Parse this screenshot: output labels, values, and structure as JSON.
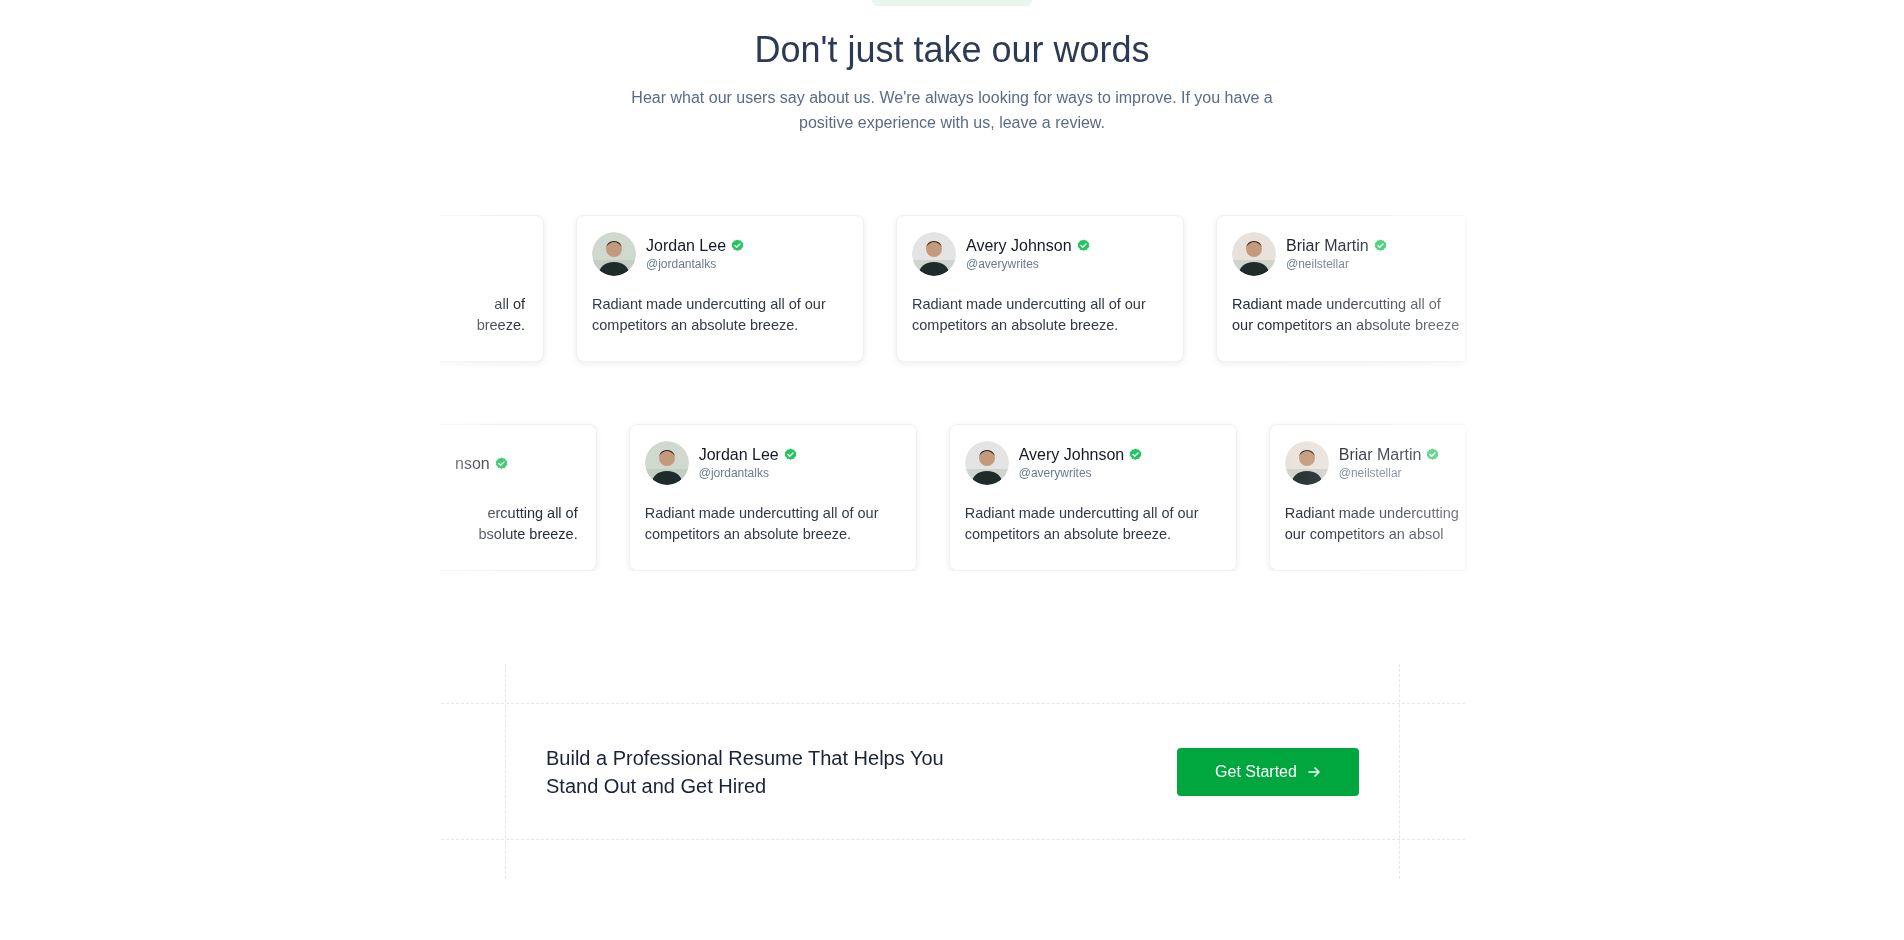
{
  "header": {
    "title": "Don't just take our words",
    "subtitle": "Hear what our users say about us. We're always looking for ways to improve. If you have a positive experience with us, leave a review."
  },
  "testimonial_rows": [
    {
      "cards": [
        {
          "kind": "cut-left",
          "lines": [
            "all of",
            "breeze."
          ]
        },
        {
          "kind": "full",
          "name": "Jordan Lee",
          "handle": "@jordantalks",
          "verified": true,
          "text": "Radiant made undercutting all of our competitors an absolute breeze."
        },
        {
          "kind": "full",
          "name": "Avery Johnson",
          "handle": "@averywrites",
          "verified": true,
          "text": "Radiant made undercutting all of our competitors an absolute breeze."
        },
        {
          "kind": "cut-right",
          "name": "Briar Martin",
          "handle": "@neilstellar",
          "verified": true,
          "lines": [
            "Radiant made undercutting all of",
            "our competitors an absolute breeze"
          ]
        }
      ]
    },
    {
      "cards": [
        {
          "kind": "cut-left",
          "name": "nson",
          "verified": true,
          "lines": [
            "ercutting all of",
            "bsolute breeze."
          ]
        },
        {
          "kind": "full",
          "name": "Jordan Lee",
          "handle": "@jordantalks",
          "verified": true,
          "text": "Radiant made undercutting all of our competitors an absolute breeze."
        },
        {
          "kind": "full",
          "name": "Avery Johnson",
          "handle": "@averywrites",
          "verified": true,
          "text": "Radiant made undercutting all of our competitors an absolute breeze."
        },
        {
          "kind": "cut-right",
          "name": "Briar Martin",
          "handle": "@neilstellar",
          "verified": true,
          "lines": [
            "Radiant made undercutting",
            "our competitors an absol"
          ]
        }
      ]
    }
  ],
  "cta": {
    "title": "Build a Professional Resume That Helps You Stand Out and Get Hired",
    "button": "Get Started"
  }
}
